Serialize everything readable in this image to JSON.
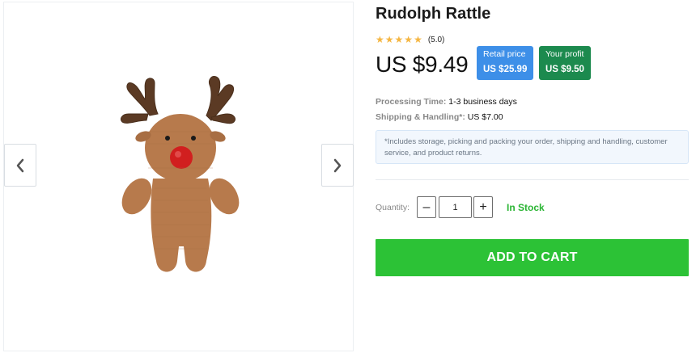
{
  "product": {
    "title": "Rudolph Rattle",
    "rating_value": "(5.0)",
    "rating_stars": 5,
    "price": "US $9.49",
    "image_alt": "Crocheted brown reindeer rattle with red nose and antlers"
  },
  "badges": {
    "retail_label": "Retail price",
    "retail_value": "US $25.99",
    "profit_label": "Your profit",
    "profit_value": "US $9.50"
  },
  "meta": {
    "processing_label": "Processing Time:",
    "processing_value": "1-3 business days",
    "shipping_label": "Shipping & Handling*:",
    "shipping_value": "US $7.00"
  },
  "note": "*Includes storage, picking and packing your order, shipping and handling, customer service, and product returns.",
  "quantity": {
    "label": "Quantity:",
    "minus": "–",
    "plus": "+",
    "value": "1",
    "stock": "In Stock"
  },
  "cart": {
    "label": "ADD TO CART"
  },
  "icons": {
    "prev": "chevron-left-icon",
    "next": "chevron-right-icon",
    "star": "star-icon"
  },
  "colors": {
    "star": "#f5b642",
    "retail_badge": "#3d8fe8",
    "profit_badge": "#1c8a4e",
    "in_stock": "#2bb534",
    "add_to_cart": "#2cc236"
  }
}
